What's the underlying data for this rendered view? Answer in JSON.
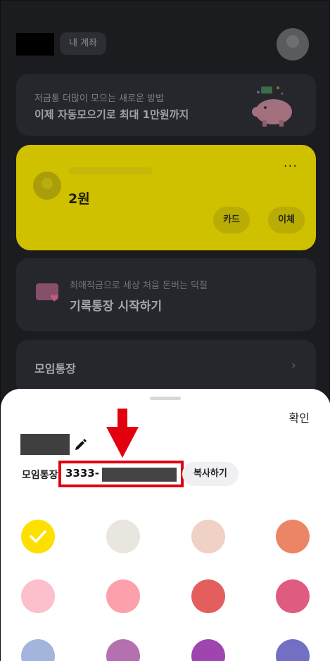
{
  "header": {
    "account_chip": "내 계좌"
  },
  "promo": {
    "subtitle": "저금통 더많이 모으는 새로운 방법",
    "title": "이제 자동모으기로 최대 1만원까지"
  },
  "main_account": {
    "balance": "2원",
    "more_label": "···",
    "card_button": "카드",
    "transfer_button": "이체"
  },
  "diary": {
    "subtitle": "최애적금으로 세상 처음 돈버는 덕질",
    "title": "기록통장 시작하기"
  },
  "group_account": {
    "label": "모임통장",
    "chevron": "›"
  },
  "sheet": {
    "confirm_label": "확인",
    "account_label": "모임통장",
    "account_number_prefix": "3333-",
    "copy_label": "복사하기",
    "colors": [
      "#fde000",
      "#e9e6e0",
      "#efd1c5",
      "#ec8466",
      "#fbc0cb",
      "#fca0ac",
      "#e45e5e",
      "#df5c80",
      "#a3b4dd",
      "#b570b0",
      "#a044b0",
      "#7170c4"
    ],
    "selected_color_index": 0
  }
}
